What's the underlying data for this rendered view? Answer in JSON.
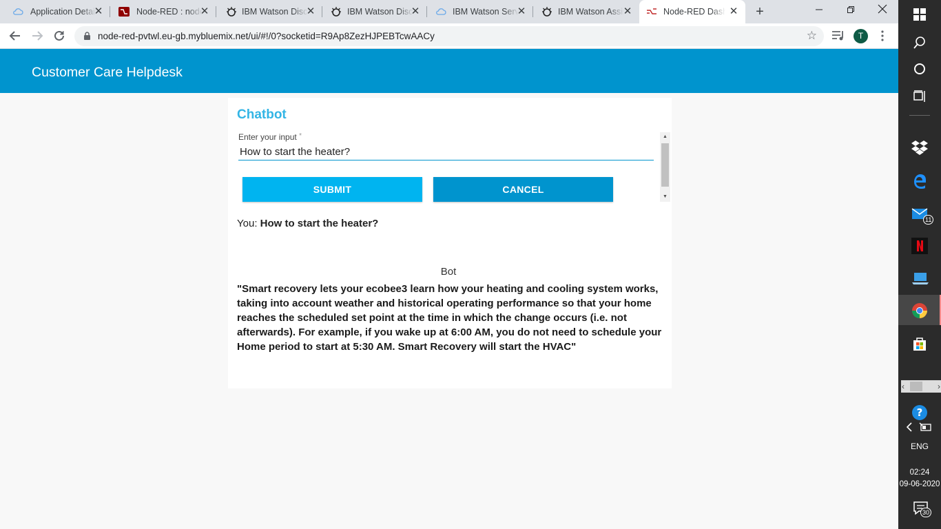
{
  "browser": {
    "tabs": [
      {
        "title": "Application Details",
        "favicon": "ibm-cloud-icon"
      },
      {
        "title": "Node-RED : node-red",
        "favicon": "node-red-icon"
      },
      {
        "title": "IBM Watson Discovery",
        "favicon": "watson-icon"
      },
      {
        "title": "IBM Watson Discovery",
        "favicon": "watson-icon"
      },
      {
        "title": "IBM Watson Services",
        "favicon": "ibm-cloud-icon"
      },
      {
        "title": "IBM Watson Assistant",
        "favicon": "watson-icon"
      },
      {
        "title": "Node-RED Dashboard",
        "favicon": "node-red-icon"
      }
    ],
    "active_tab_index": 6,
    "tab_close_glyph": "✕",
    "new_tab_glyph": "+",
    "url": "node-red-pvtwl.eu-gb.mybluemix.net/ui/#!/0?socketid=R9Ap8ZezHJPEBTcwAACy",
    "profile_initial": "T"
  },
  "dashboard": {
    "header_title": "Customer Care Helpdesk",
    "header_color": "#0094ce"
  },
  "chatbot": {
    "title": "Chatbot",
    "input_label": "Enter your input",
    "required_mark": "*",
    "input_value": "How to start the heater?",
    "submit_label": "SUBMIT",
    "cancel_label": "CANCEL",
    "user_prefix": "You:",
    "user_message": "How to start the heater?",
    "bot_label": "Bot",
    "bot_message": "\"Smart recovery lets your ecobee3 learn how your heating and cooling system works, taking into account weather and historical operating performance so that your home reaches the scheduled set point at the time in which the change occurs (i.e. not afterwards). For example, if you wake up at 6:00 AM, you do not need to schedule your Home period to start at 5:30 AM. Smart Recovery will start the HVAC\""
  },
  "taskbar": {
    "mail_badge": "11",
    "language": "ENG",
    "time": "02:24",
    "date": "09-06-2020",
    "notification_count": "30"
  }
}
